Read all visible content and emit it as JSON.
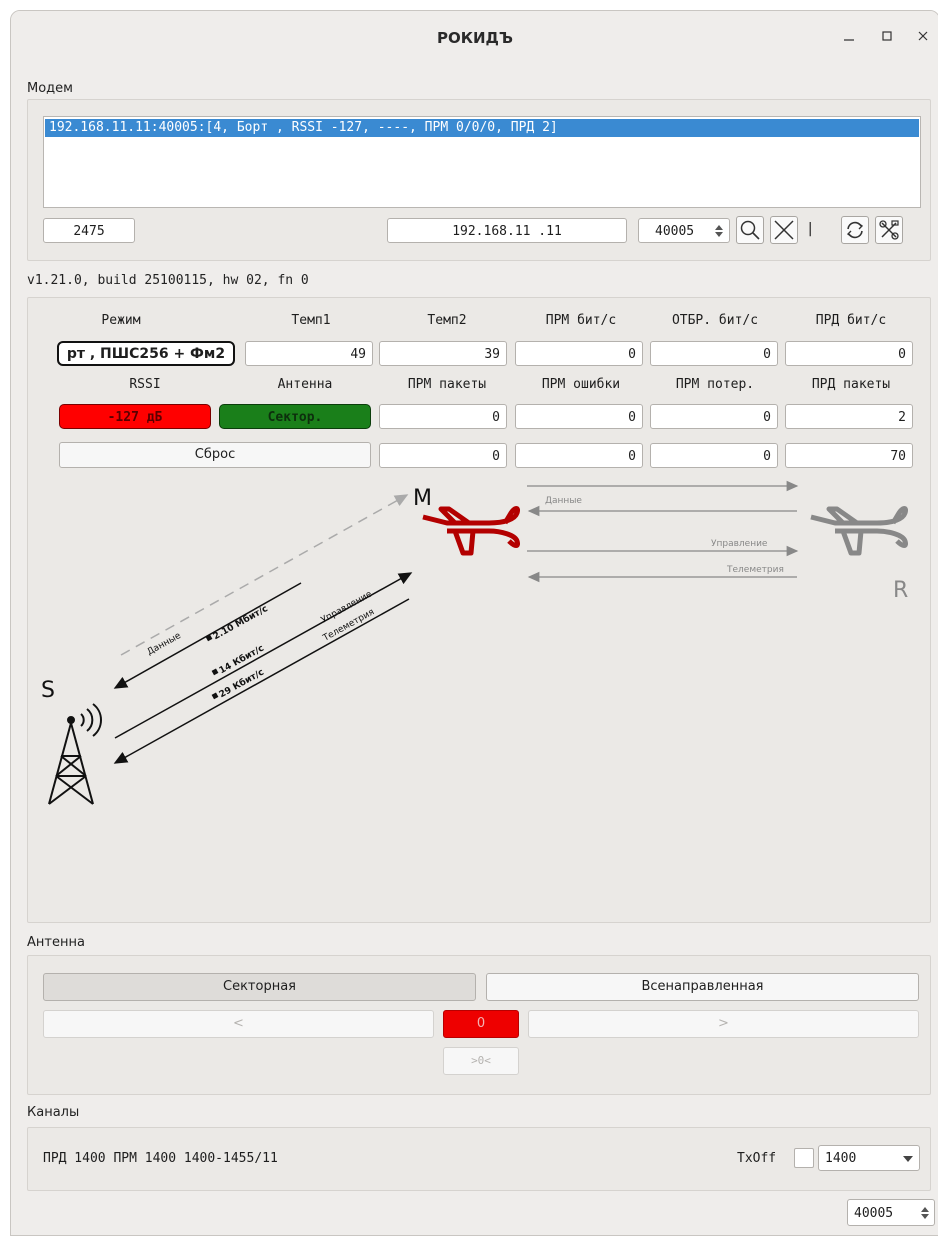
{
  "window": {
    "title": "РОКИДЪ",
    "minimize_icon": "minimize-icon",
    "maximize_icon": "maximize-icon",
    "close_icon": "close-icon"
  },
  "modem": {
    "section_label": "Модем",
    "list_items": [
      "192.168.11.11:40005:[4, Борт , RSSI -127, ----, ПРМ 0/0/0, ПРД 2]"
    ],
    "port_field": "2475",
    "ip_field": "192.168.11 .11",
    "port_spin": "40005",
    "version": "v1.21.0, build 25100115, hw 02, fn 0",
    "separator": "|",
    "icons": [
      "search-icon",
      "close-icon",
      "refresh-icon",
      "settings-tools-icon"
    ]
  },
  "stats": {
    "headers_row1": [
      "Режим",
      "Темп1",
      "Темп2",
      "ПРМ бит/с",
      "ОТБР. бит/с",
      "ПРД бит/с"
    ],
    "mode_value": "рт , ПШС256 + Фм2",
    "temp1": "49",
    "temp2": "39",
    "rx_bps": "0",
    "drop_bps": "0",
    "tx_bps": "0",
    "headers_row2": [
      "RSSI",
      "Антенна",
      "ПРМ пакеты",
      "ПРМ ошибки",
      "ПРМ потер.",
      "ПРД пакеты"
    ],
    "rssi_value": "-127 дБ",
    "antenna_value": "Сектор.",
    "rx_packets": "0",
    "rx_errors": "0",
    "rx_lost": "0",
    "tx_packets": "2",
    "reset_button": "Сброс",
    "row3": [
      "0",
      "0",
      "0",
      "70"
    ],
    "colors": {
      "rssi_bg": "#ff0000",
      "antenna_bg": "#1a7f1a"
    }
  },
  "diagram": {
    "node_s": "S",
    "node_m": "M",
    "node_r": "R",
    "link_data": "Данные",
    "link_data_rate": "2.10 Мбит/с",
    "link_control": "Управление",
    "link_control_rate": "14 Кбит/с",
    "link_telemetry": "Телеметрия",
    "link_telemetry_rate": "29 Кбит/с",
    "relay_data": "Данные",
    "relay_control": "Управление",
    "relay_telemetry": "Телеметрия",
    "colors": {
      "plane_m": "#b30000",
      "plane_r": "#808080"
    },
    "icons": [
      "antenna-tower-icon",
      "plane-icon",
      "lock-icon"
    ]
  },
  "antenna": {
    "section_label": "Антенна",
    "sector_button": "Секторная",
    "omni_button": "Всенаправленная",
    "left_button": "<",
    "value": "0",
    "right_button": ">",
    "center_button": ">0<",
    "colors": {
      "value_bg": "#ee0000"
    }
  },
  "channels": {
    "section_label": "Каналы",
    "summary": "ПРД 1400 ПРМ 1400 1400-1455/11",
    "txoff_label": "TxOff",
    "channel_select": "1400",
    "port_spin": "40005"
  }
}
